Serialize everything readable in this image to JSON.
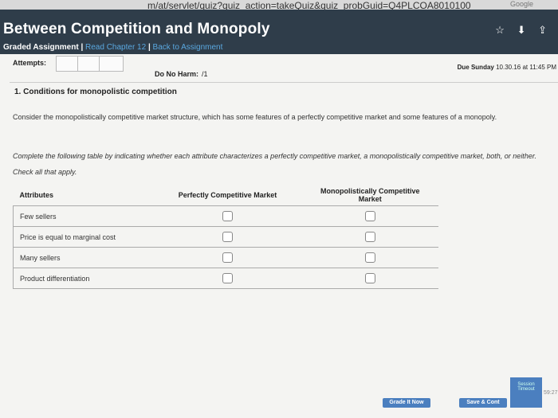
{
  "browser": {
    "url": "m/at/servlet/quiz?quiz_action=takeQuiz&quiz_probGuid=Q4PLCOA8010100",
    "right_text": "Google"
  },
  "header": {
    "title": "Between Competition and Monopoly",
    "assignment_type": "Graded Assignment",
    "read_chapter": "Read Chapter 12",
    "back_link": "Back to Assignment"
  },
  "status": {
    "attempts_label": "Attempts:",
    "no_harm_label": "Do No Harm:",
    "no_harm_value": "/1",
    "due_label": "Due Sunday",
    "due_value": "10.30.16 at 11:45 PM"
  },
  "question": {
    "title": "1. Conditions for monopolistic competition",
    "intro": "Consider the monopolistically competitive market structure, which has some features of a perfectly competitive market and some features of a monopoly.",
    "instructions": "Complete the following table by indicating whether each attribute characterizes a perfectly competitive market, a monopolistically competitive market, both, or neither. Check all that apply."
  },
  "table": {
    "headers": [
      "Attributes",
      "Perfectly Competitive Market",
      "Monopolistically Competitive Market"
    ],
    "rows": [
      {
        "attribute": "Few sellers",
        "perfect": false,
        "monopolistic": false
      },
      {
        "attribute": "Price is equal to marginal cost",
        "perfect": false,
        "monopolistic": false
      },
      {
        "attribute": "Many sellers",
        "perfect": false,
        "monopolistic": false
      },
      {
        "attribute": "Product differentiation",
        "perfect": false,
        "monopolistic": false
      }
    ]
  },
  "footer": {
    "grade_button": "Grade It Now",
    "save_button": "Save & Cont",
    "session_label": "Session Timeout",
    "session_value": "59:27"
  }
}
